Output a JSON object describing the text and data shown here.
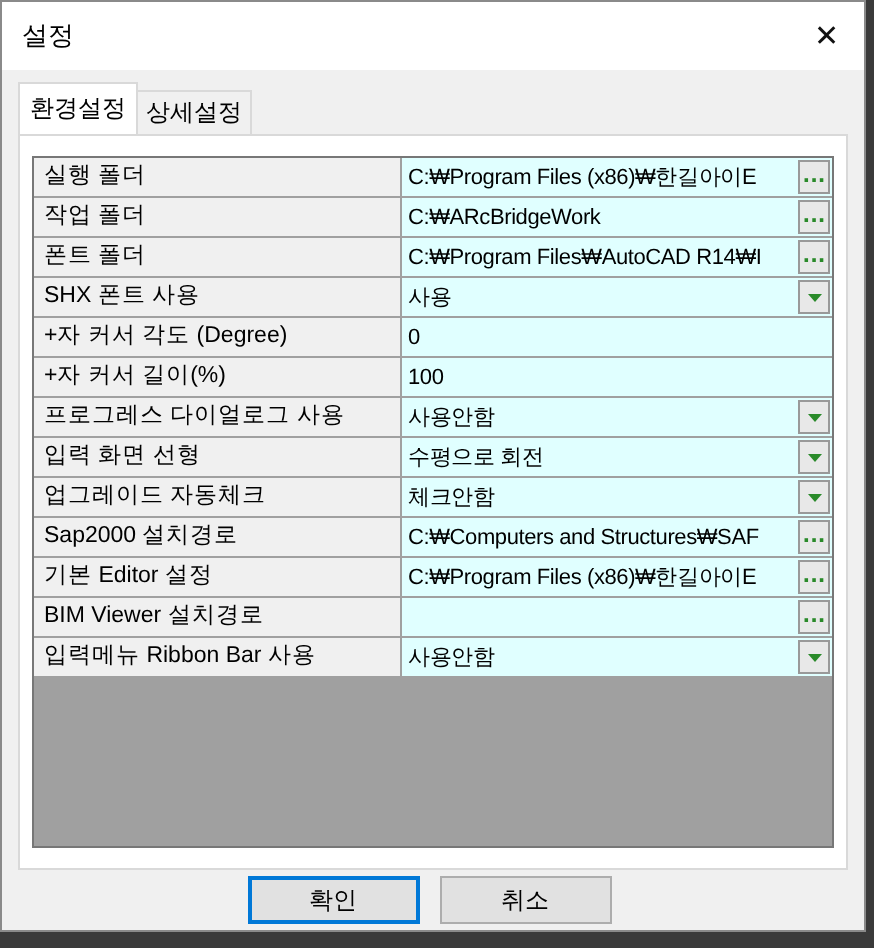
{
  "window": {
    "title": "설정",
    "close": "✕"
  },
  "tabs": [
    {
      "label": "환경설정",
      "selected": true
    },
    {
      "label": "상세설정",
      "selected": false
    }
  ],
  "rows": [
    {
      "label": "실행 폴더",
      "value": "C:₩Program Files (x86)₩한길아이E",
      "kind": "path",
      "button": "..."
    },
    {
      "label": "작업 폴더",
      "value": "C:₩ARcBridgeWork",
      "kind": "path",
      "button": "..."
    },
    {
      "label": "폰트 폴더",
      "value": "C:₩Program Files₩AutoCAD R14₩I",
      "kind": "path",
      "button": "..."
    },
    {
      "label": "SHX 폰트 사용",
      "value": "사용",
      "kind": "dropdown"
    },
    {
      "label": "+자 커서 각도 (Degree)",
      "value": "0",
      "kind": "text"
    },
    {
      "label": "+자 커서 길이(%)",
      "value": "100",
      "kind": "text"
    },
    {
      "label": "프로그레스 다이얼로그 사용",
      "value": "사용안함",
      "kind": "dropdown"
    },
    {
      "label": "입력 화면 선형",
      "value": "수평으로 회전",
      "kind": "dropdown"
    },
    {
      "label": "업그레이드 자동체크",
      "value": "체크안함",
      "kind": "dropdown"
    },
    {
      "label": "Sap2000 설치경로",
      "value": "C:₩Computers and Structures₩SAF",
      "kind": "path",
      "button": "..."
    },
    {
      "label": "기본 Editor 설정",
      "value": "C:₩Program Files (x86)₩한길아이E",
      "kind": "path",
      "button": "..."
    },
    {
      "label": "BIM Viewer 설치경로",
      "kind": "path",
      "button": "..."
    },
    {
      "label": "입력메뉴 Ribbon Bar 사용",
      "value": "사용안함",
      "kind": "dropdown"
    }
  ],
  "buttons": [
    {
      "label": "확인",
      "default": true
    },
    {
      "label": "취소",
      "default": false
    }
  ]
}
